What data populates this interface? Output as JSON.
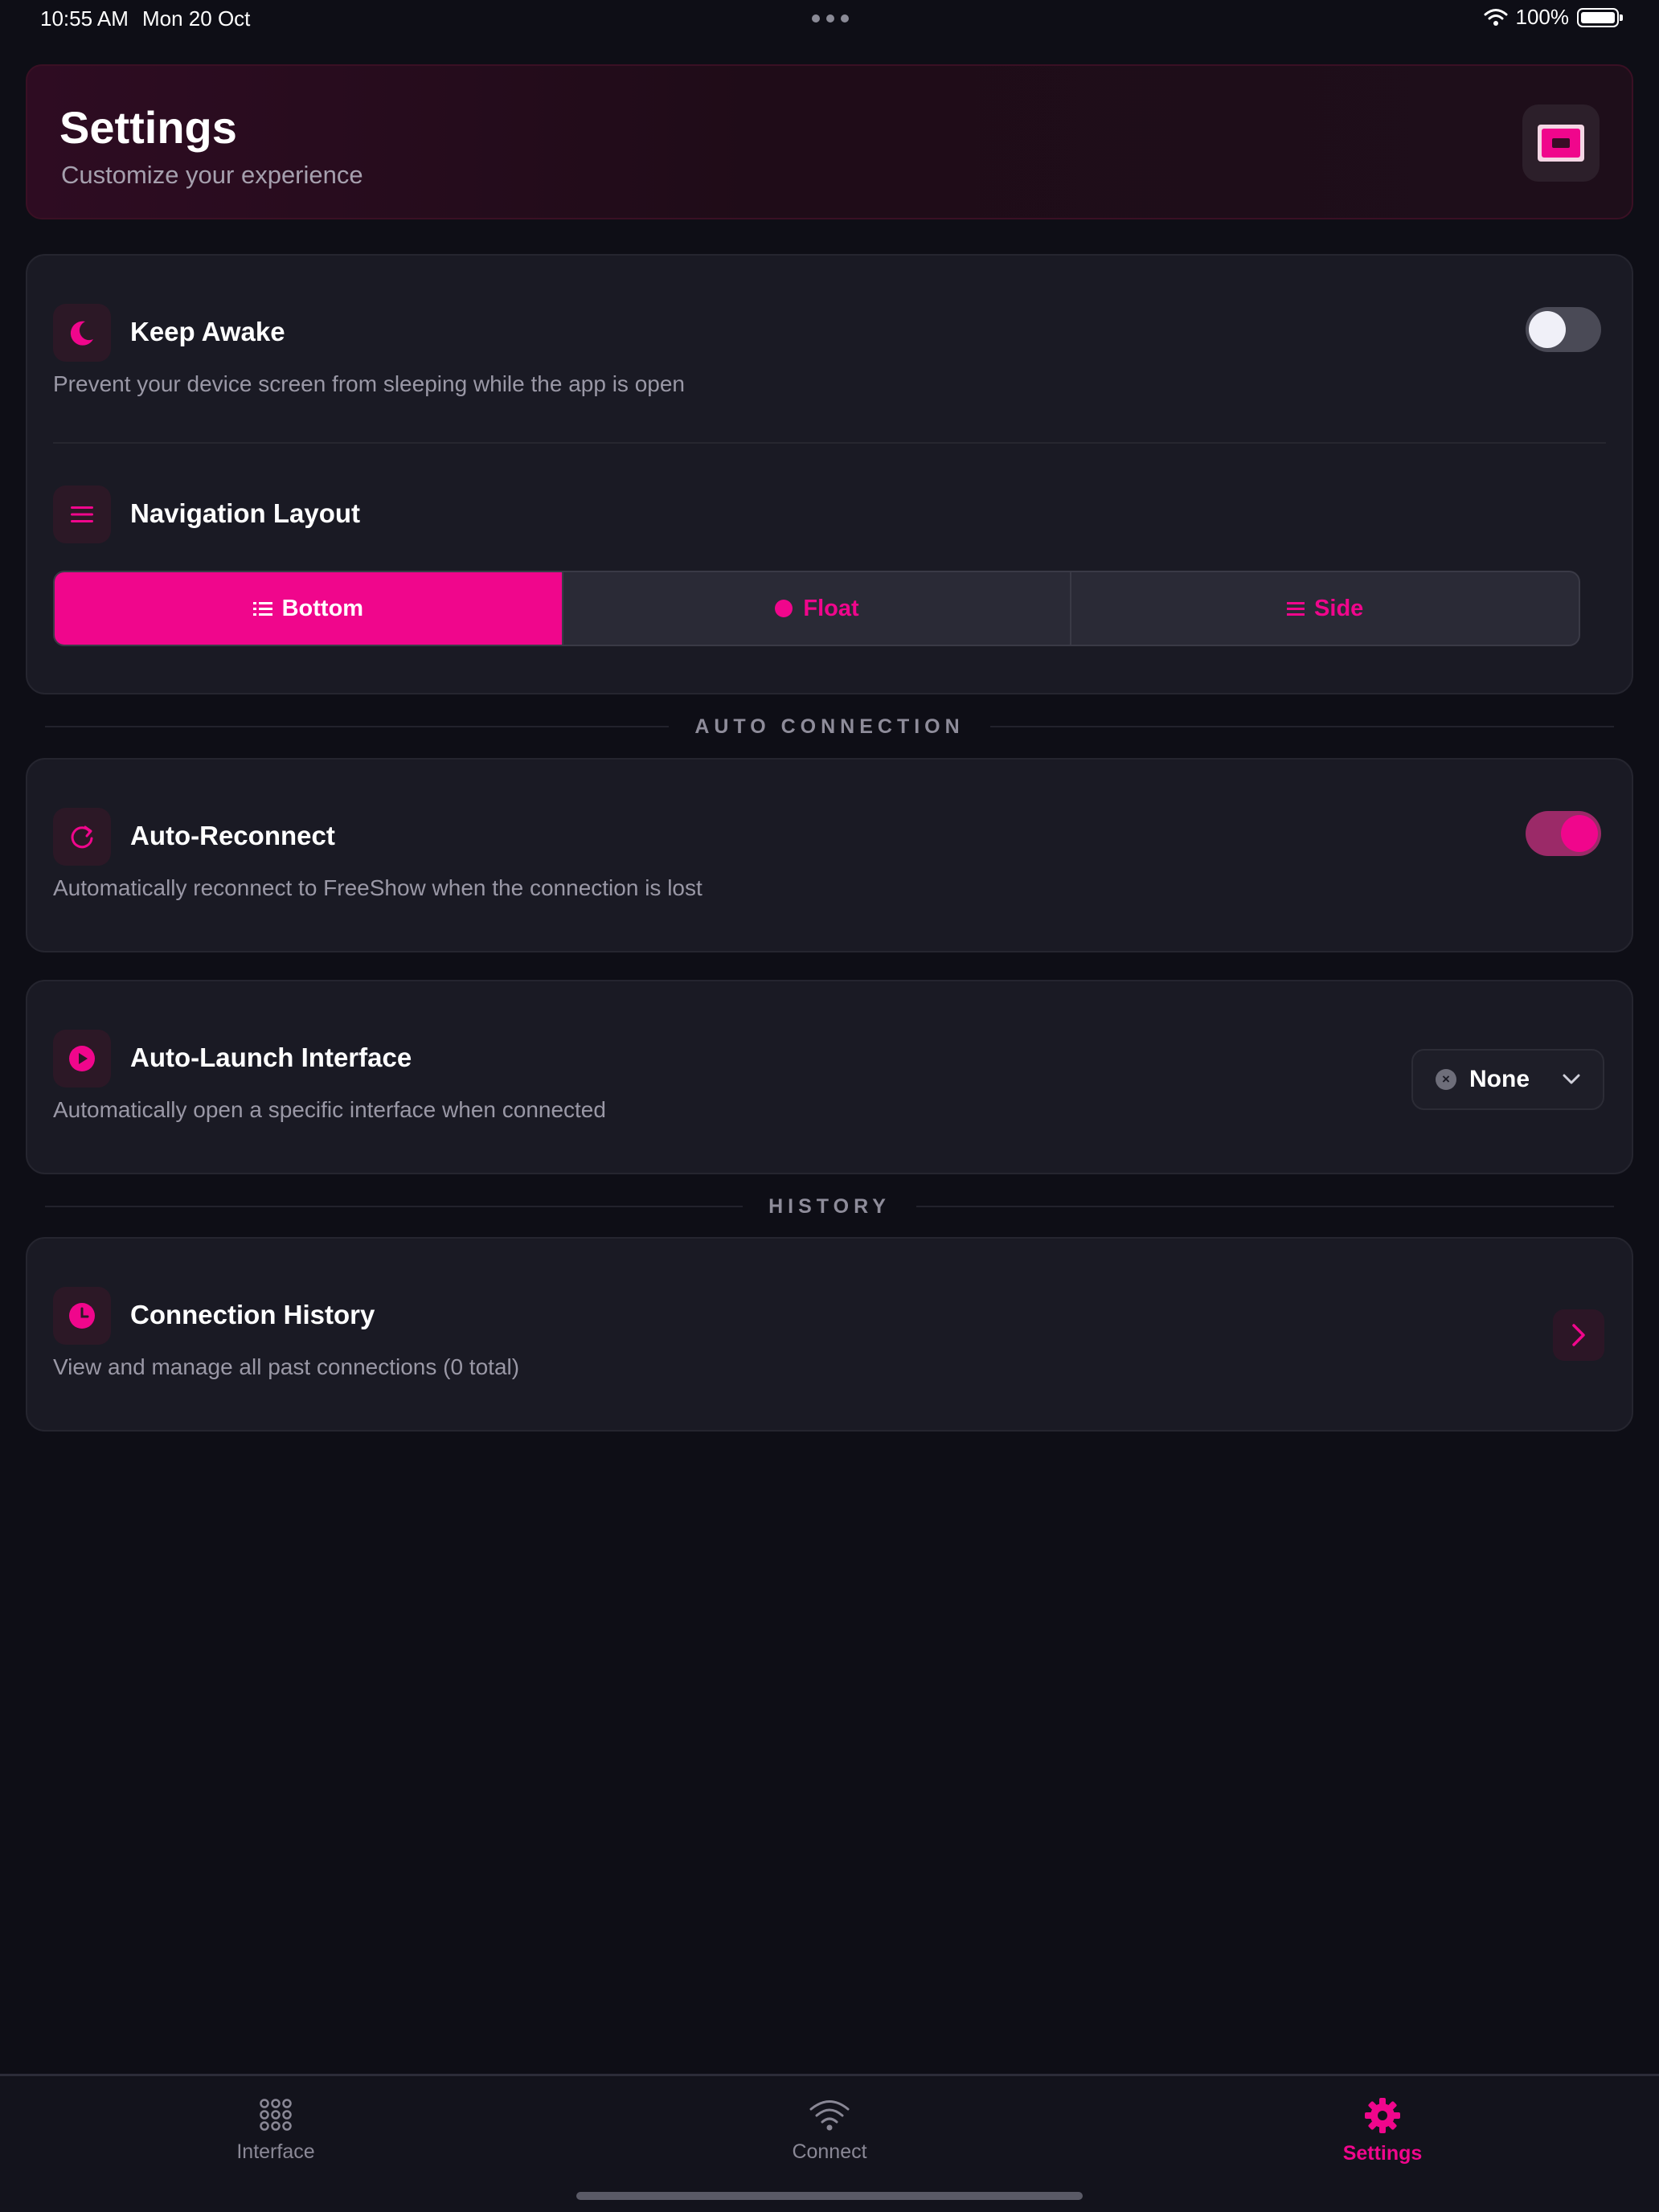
{
  "status_bar": {
    "time": "10:55 AM",
    "date": "Mon 20 Oct",
    "battery": "100%"
  },
  "header": {
    "title": "Settings",
    "subtitle": "Customize your experience",
    "icon": "app-logo-icon"
  },
  "settings": {
    "keep_awake": {
      "title": "Keep Awake",
      "description": "Prevent your device screen from sleeping while the app is open",
      "enabled": false,
      "icon": "moon-icon"
    },
    "navigation_layout": {
      "title": "Navigation Layout",
      "icon": "menu-icon",
      "options": [
        {
          "label": "Bottom",
          "icon": "list-icon",
          "selected": true
        },
        {
          "label": "Float",
          "icon": "dot-icon",
          "selected": false
        },
        {
          "label": "Side",
          "icon": "menu-icon",
          "selected": false
        }
      ]
    }
  },
  "sections": {
    "auto_connection": "AUTO CONNECTION",
    "history": "HISTORY"
  },
  "auto_reconnect": {
    "title": "Auto-Reconnect",
    "description": "Automatically reconnect to FreeShow when the connection is lost",
    "enabled": true,
    "icon": "refresh-icon"
  },
  "auto_launch": {
    "title": "Auto-Launch Interface",
    "description": "Automatically open a specific interface when connected",
    "selected_value": "None",
    "icon": "play-icon"
  },
  "connection_history": {
    "title": "Connection History",
    "description": "View and manage all past connections (0 total)",
    "icon": "clock-icon"
  },
  "bottom_nav": {
    "items": [
      {
        "label": "Interface",
        "icon": "grid-icon",
        "active": false
      },
      {
        "label": "Connect",
        "icon": "wifi-icon",
        "active": false
      },
      {
        "label": "Settings",
        "icon": "gear-icon",
        "active": true
      }
    ]
  },
  "colors": {
    "accent": "#f0068c",
    "background": "#0e0e16",
    "card": "#1a1a24",
    "muted_text": "#9a98a6"
  }
}
